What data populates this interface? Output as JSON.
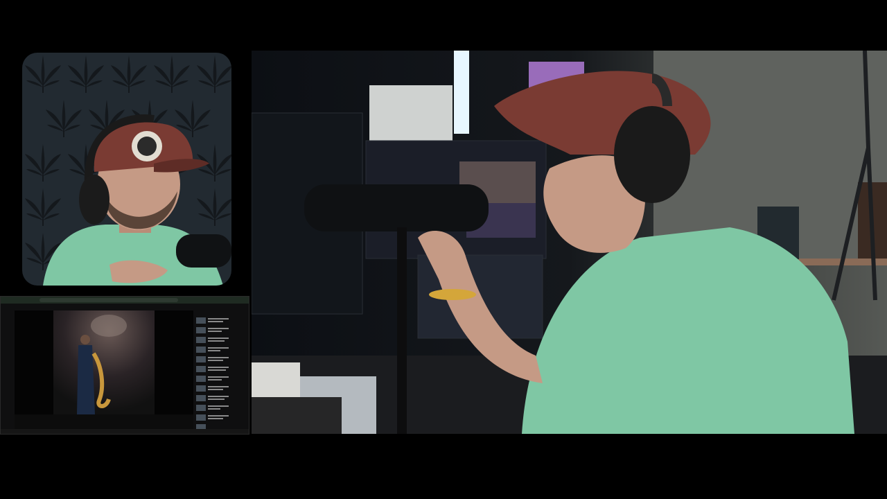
{
  "colors": {
    "background": "#000000",
    "facecam_wall": "#222a31",
    "cap": "#7a3b33",
    "shirt": "#7fc7a4",
    "screen_accent": "#3a7a4a",
    "light_strip": "#e8f7ff",
    "purple_light": "#b07bd6"
  },
  "icons": {
    "facecam_pattern": "cannabis-leaf-pattern",
    "microphone": "microphone-icon",
    "headphones": "headphones-icon",
    "saxophone": "saxophone-figure"
  }
}
